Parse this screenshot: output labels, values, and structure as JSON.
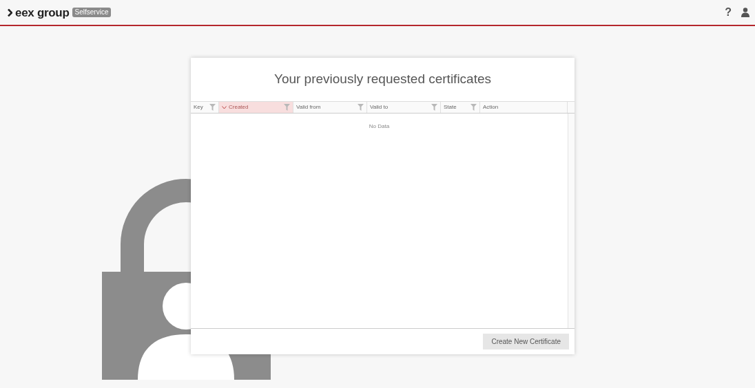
{
  "header": {
    "brand": "eex group",
    "badge": "Selfservice",
    "help": "?"
  },
  "dialog": {
    "title": "Your previously requested certificates",
    "table": {
      "columns": [
        {
          "label": "Key",
          "sorted": false,
          "filterable": true
        },
        {
          "label": "Created",
          "sorted": true,
          "filterable": true
        },
        {
          "label": "Valid from",
          "sorted": false,
          "filterable": true
        },
        {
          "label": "Valid to",
          "sorted": false,
          "filterable": true
        },
        {
          "label": "State",
          "sorted": false,
          "filterable": true
        },
        {
          "label": "Action",
          "sorted": false,
          "filterable": false
        }
      ],
      "empty_text": "No Data"
    },
    "button": "Create New Certificate"
  }
}
